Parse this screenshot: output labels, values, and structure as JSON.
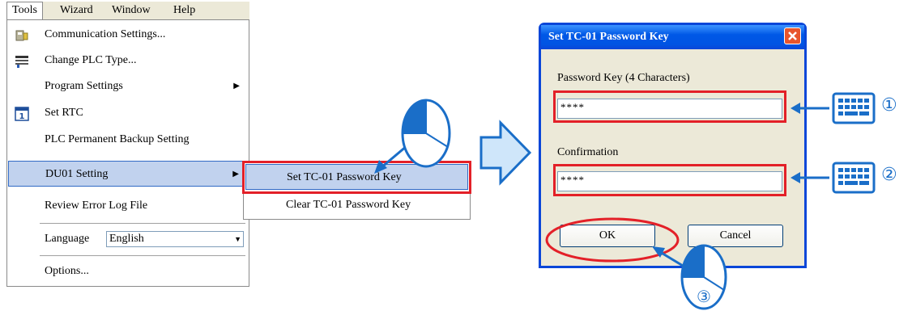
{
  "menubar": {
    "items": [
      {
        "label": "Tools"
      },
      {
        "label": "Wizard"
      },
      {
        "label": "Window"
      },
      {
        "label": "Help"
      }
    ]
  },
  "tools_menu": {
    "items": [
      {
        "label": "Communication Settings...",
        "icon": "communication-icon"
      },
      {
        "label": "Change PLC Type...",
        "icon": "plc-type-icon"
      },
      {
        "label": "Program Settings",
        "submenu": true
      },
      {
        "label": "Set RTC",
        "icon": "calendar-icon"
      },
      {
        "label": "PLC Permanent Backup Setting"
      },
      {
        "label": "DU01 Setting",
        "submenu": true,
        "highlighted": true
      },
      {
        "label": "Review Error Log File"
      },
      {
        "label": "Language",
        "value": "English"
      },
      {
        "label": "Options..."
      }
    ]
  },
  "du01_submenu": {
    "items": [
      {
        "label": "Set TC-01 Password Key",
        "highlighted": true
      },
      {
        "label": "Clear TC-01 Password Key"
      }
    ]
  },
  "dialog": {
    "title": "Set TC-01 Password Key",
    "password_label": "Password Key (4 Characters)",
    "password_value": "****",
    "confirmation_label": "Confirmation",
    "confirmation_value": "****",
    "ok_label": "OK",
    "cancel_label": "Cancel"
  },
  "annotations": {
    "step1": "①",
    "step2": "②",
    "step3": "③"
  },
  "colors": {
    "highlight_red": "#e32028",
    "arrow_blue": "#1a6ec8",
    "menu_highlight": "#c1d2ee",
    "titlebar_blue": "#0054e3"
  }
}
